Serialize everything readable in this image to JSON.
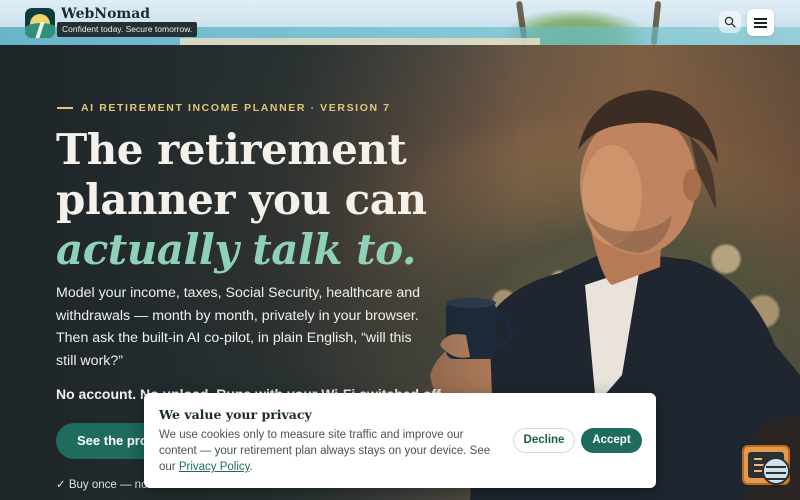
{
  "header": {
    "brand_name": "WebNomad",
    "tagline": "Confident today. Secure tomorrow.",
    "search_icon": "search-icon",
    "menu_icon": "hamburger-menu-icon"
  },
  "hero": {
    "kicker": "AI RETIREMENT INCOME PLANNER · VERSION 7",
    "headline_line1": "The retirement",
    "headline_line2": "planner you can",
    "headline_accent": "actually talk to.",
    "lede": "Model your income, taxes, Social Security, healthcare and withdrawals — month by month, privately in your browser. Then ask the built-in AI co-pilot, in plain English, “will this still work?”",
    "note": "No account. No upload. Runs with your Wi-Fi switched off.",
    "cta_label": "See the pro",
    "fine_print": "✓ Buy once — no"
  },
  "cookie_banner": {
    "title": "We value your privacy",
    "text_before_link": "We use cookies only to measure site traffic and improve our content — your retirement plan always stays on your device. See our ",
    "link_text": "Privacy Policy",
    "text_after_link": ".",
    "decline_label": "Decline",
    "accept_label": "Accept"
  },
  "chat_widget": {
    "icon": "ai-copilot-chat-icon"
  },
  "colors": {
    "accent_green": "#1f6b5e",
    "headline_accent": "#8fd0b9",
    "kicker_gold": "#e5c57a",
    "cookie_bg": "#ffffff"
  }
}
